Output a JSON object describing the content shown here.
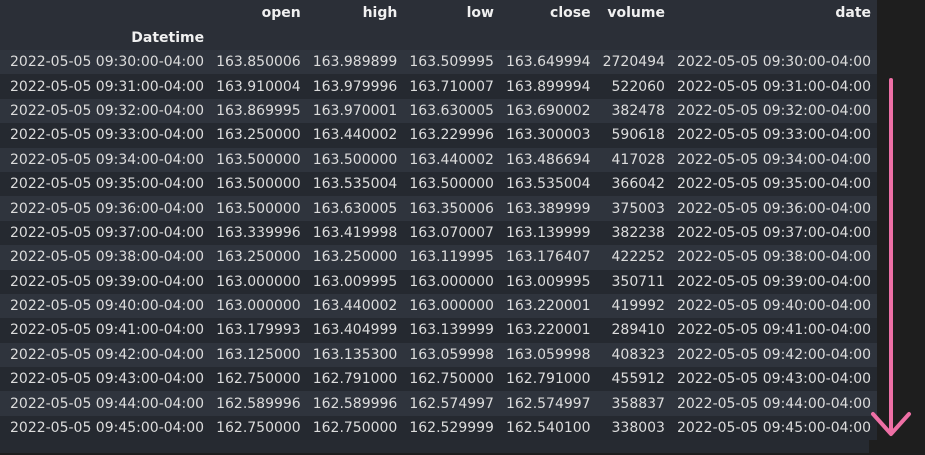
{
  "table": {
    "index_name": "Datetime",
    "columns": [
      "open",
      "high",
      "low",
      "close",
      "volume",
      "date"
    ],
    "rows": [
      {
        "index": "2022-05-05 09:30:00-04:00",
        "open": "163.850006",
        "high": "163.989899",
        "low": "163.509995",
        "close": "163.649994",
        "volume": "2720494",
        "date": "2022-05-05 09:30:00-04:00"
      },
      {
        "index": "2022-05-05 09:31:00-04:00",
        "open": "163.910004",
        "high": "163.979996",
        "low": "163.710007",
        "close": "163.899994",
        "volume": "522060",
        "date": "2022-05-05 09:31:00-04:00"
      },
      {
        "index": "2022-05-05 09:32:00-04:00",
        "open": "163.869995",
        "high": "163.970001",
        "low": "163.630005",
        "close": "163.690002",
        "volume": "382478",
        "date": "2022-05-05 09:32:00-04:00"
      },
      {
        "index": "2022-05-05 09:33:00-04:00",
        "open": "163.250000",
        "high": "163.440002",
        "low": "163.229996",
        "close": "163.300003",
        "volume": "590618",
        "date": "2022-05-05 09:33:00-04:00"
      },
      {
        "index": "2022-05-05 09:34:00-04:00",
        "open": "163.500000",
        "high": "163.500000",
        "low": "163.440002",
        "close": "163.486694",
        "volume": "417028",
        "date": "2022-05-05 09:34:00-04:00"
      },
      {
        "index": "2022-05-05 09:35:00-04:00",
        "open": "163.500000",
        "high": "163.535004",
        "low": "163.500000",
        "close": "163.535004",
        "volume": "366042",
        "date": "2022-05-05 09:35:00-04:00"
      },
      {
        "index": "2022-05-05 09:36:00-04:00",
        "open": "163.500000",
        "high": "163.630005",
        "low": "163.350006",
        "close": "163.389999",
        "volume": "375003",
        "date": "2022-05-05 09:36:00-04:00"
      },
      {
        "index": "2022-05-05 09:37:00-04:00",
        "open": "163.339996",
        "high": "163.419998",
        "low": "163.070007",
        "close": "163.139999",
        "volume": "382238",
        "date": "2022-05-05 09:37:00-04:00"
      },
      {
        "index": "2022-05-05 09:38:00-04:00",
        "open": "163.250000",
        "high": "163.250000",
        "low": "163.119995",
        "close": "163.176407",
        "volume": "422252",
        "date": "2022-05-05 09:38:00-04:00"
      },
      {
        "index": "2022-05-05 09:39:00-04:00",
        "open": "163.000000",
        "high": "163.009995",
        "low": "163.000000",
        "close": "163.009995",
        "volume": "350711",
        "date": "2022-05-05 09:39:00-04:00"
      },
      {
        "index": "2022-05-05 09:40:00-04:00",
        "open": "163.000000",
        "high": "163.440002",
        "low": "163.000000",
        "close": "163.220001",
        "volume": "419992",
        "date": "2022-05-05 09:40:00-04:00"
      },
      {
        "index": "2022-05-05 09:41:00-04:00",
        "open": "163.179993",
        "high": "163.404999",
        "low": "163.139999",
        "close": "163.220001",
        "volume": "289410",
        "date": "2022-05-05 09:41:00-04:00"
      },
      {
        "index": "2022-05-05 09:42:00-04:00",
        "open": "163.125000",
        "high": "163.135300",
        "low": "163.059998",
        "close": "163.059998",
        "volume": "408323",
        "date": "2022-05-05 09:42:00-04:00"
      },
      {
        "index": "2022-05-05 09:43:00-04:00",
        "open": "162.750000",
        "high": "162.791000",
        "low": "162.750000",
        "close": "162.791000",
        "volume": "455912",
        "date": "2022-05-05 09:43:00-04:00"
      },
      {
        "index": "2022-05-05 09:44:00-04:00",
        "open": "162.589996",
        "high": "162.589996",
        "low": "162.574997",
        "close": "162.574997",
        "volume": "358837",
        "date": "2022-05-05 09:44:00-04:00"
      },
      {
        "index": "2022-05-05 09:45:00-04:00",
        "open": "162.750000",
        "high": "162.750000",
        "low": "162.529999",
        "close": "162.540100",
        "volume": "338003",
        "date": "2022-05-05 09:45:00-04:00"
      }
    ]
  },
  "colors": {
    "background": "#262a31",
    "row_stripe": "#2f343d",
    "text": "#dcdcdc",
    "arrow": "#ee6fa5"
  },
  "annotation": {
    "icon": "down-arrow-icon"
  }
}
